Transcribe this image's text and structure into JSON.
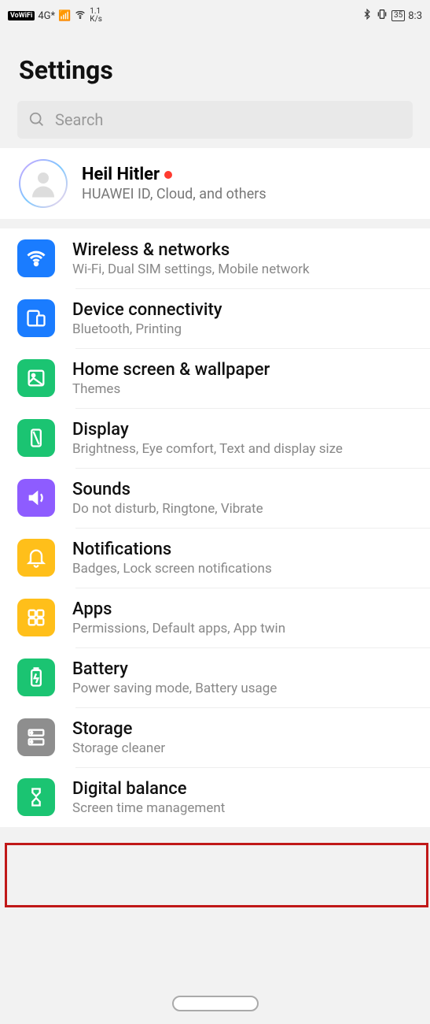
{
  "status": {
    "vowifi": "VoWiFi",
    "network": "4G*",
    "speed_top": "1.1",
    "speed_bot": "K/s",
    "battery": "35",
    "time": "8:3"
  },
  "page_title": "Settings",
  "search": {
    "placeholder": "Search"
  },
  "account": {
    "name": "Heil Hitler",
    "sub": "HUAWEI ID, Cloud, and others"
  },
  "items": [
    {
      "title": "Wireless & networks",
      "sub": "Wi-Fi, Dual SIM settings, Mobile network"
    },
    {
      "title": "Device connectivity",
      "sub": "Bluetooth, Printing"
    },
    {
      "title": "Home screen & wallpaper",
      "sub": "Themes"
    },
    {
      "title": "Display",
      "sub": "Brightness, Eye comfort, Text and display size"
    },
    {
      "title": "Sounds",
      "sub": "Do not disturb, Ringtone, Vibrate"
    },
    {
      "title": "Notifications",
      "sub": "Badges, Lock screen notifications"
    },
    {
      "title": "Apps",
      "sub": "Permissions, Default apps, App twin"
    },
    {
      "title": "Battery",
      "sub": "Power saving mode, Battery usage"
    },
    {
      "title": "Storage",
      "sub": "Storage cleaner"
    },
    {
      "title": "Digital balance",
      "sub": "Screen time management"
    }
  ]
}
